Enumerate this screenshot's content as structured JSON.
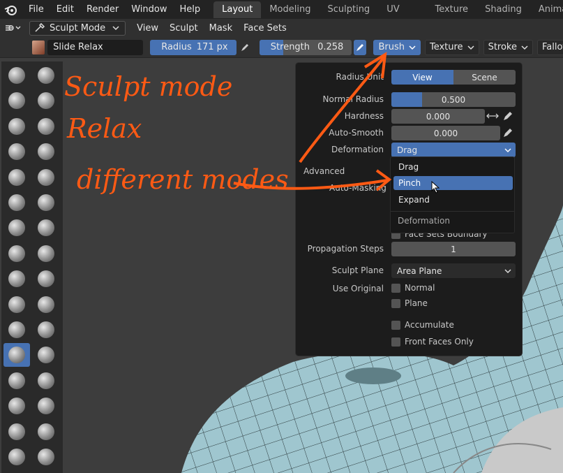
{
  "menubar": {
    "items": [
      "File",
      "Edit",
      "Render",
      "Window",
      "Help"
    ],
    "workspaces": [
      {
        "label": "Layout",
        "active": true
      },
      {
        "label": "Modeling",
        "active": false
      },
      {
        "label": "Sculpting",
        "active": false
      },
      {
        "label": "UV Editing",
        "active": false
      },
      {
        "label": "Texture Paint",
        "active": false
      },
      {
        "label": "Shading",
        "active": false
      },
      {
        "label": "Animation",
        "active": false
      }
    ]
  },
  "header": {
    "mode": "Sculpt Mode",
    "menus": [
      "View",
      "Sculpt",
      "Mask",
      "Face Sets"
    ]
  },
  "toolrow": {
    "brush_name": "Slide Relax",
    "radius_label": "Radius",
    "radius_value": "171 px",
    "strength_label": "Strength",
    "strength_value": "0.258",
    "strength_fraction": 0.258,
    "dropdowns": [
      "Brush",
      "Texture",
      "Stroke",
      "Falloff"
    ]
  },
  "panel": {
    "radius_unit_label": "Radius Unit",
    "radius_unit_view": "View",
    "radius_unit_scene": "Scene",
    "normal_radius_label": "Normal Radius",
    "normal_radius_value": "0.500",
    "hardness_label": "Hardness",
    "hardness_value": "0.000",
    "auto_smooth_label": "Auto-Smooth",
    "auto_smooth_value": "0.000",
    "deformation_label": "Deformation",
    "deformation_value": "Drag",
    "advanced_label": "Advanced",
    "auto_masking_label": "Auto-Masking",
    "face_sets_boundary": "Face Sets Boundary",
    "propagation_label": "Propagation Steps",
    "propagation_value": "1",
    "sculpt_plane_label": "Sculpt Plane",
    "sculpt_plane_value": "Area Plane",
    "use_original_label": "Use Original",
    "normal_check": "Normal",
    "plane_check": "Plane",
    "accumulate_check": "Accumulate",
    "front_faces_check": "Front Faces Only"
  },
  "deformation_menu": {
    "options": [
      {
        "label": "Drag",
        "highlighted": false
      },
      {
        "label": "Pinch",
        "highlighted": true
      },
      {
        "label": "Expand",
        "highlighted": false
      }
    ],
    "title": "Deformation"
  },
  "annotations": {
    "line1": "Sculpt mode",
    "line2": "Relax",
    "line3": "different modes",
    "color": "#ff5a14"
  },
  "colors": {
    "accent": "#4772b3",
    "panel_bg": "#1c1c1c",
    "mesh": "#9fc6cf"
  }
}
